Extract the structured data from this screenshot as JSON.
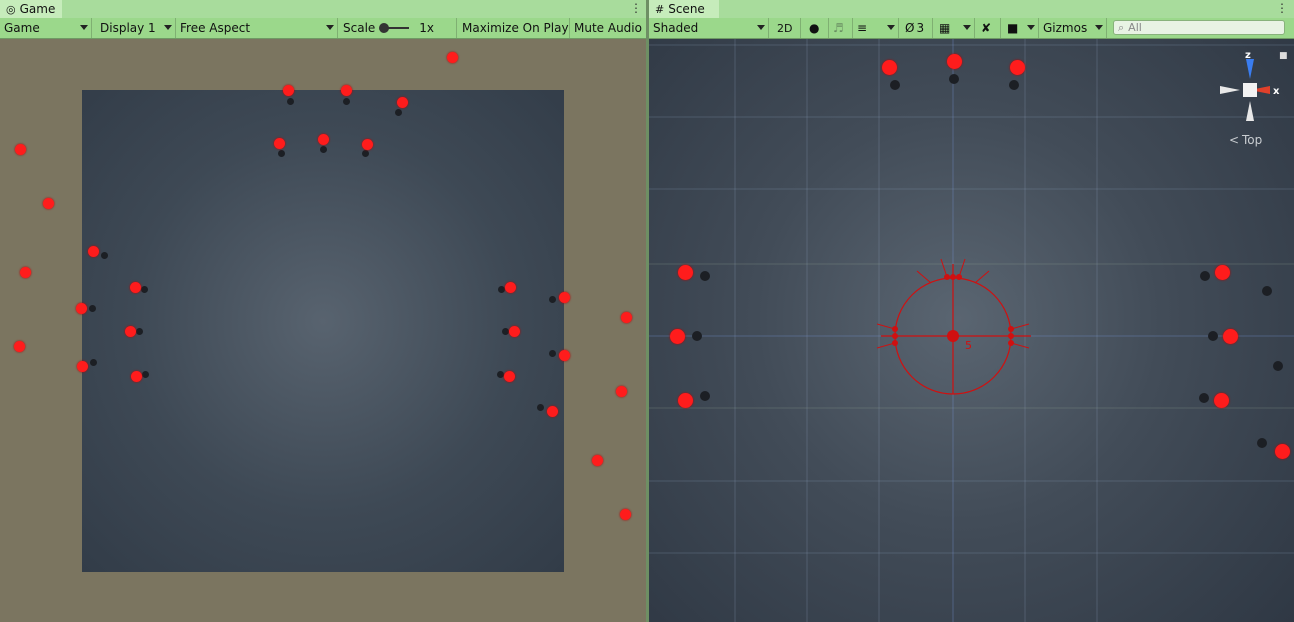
{
  "game_panel": {
    "tab_label": "Game",
    "toolbar": {
      "view_select": "Game",
      "display_select": "Display 1",
      "aspect_select": "Free Aspect",
      "scale_label": "Scale",
      "scale_value": "1x",
      "maximize_label": "Maximize On Play",
      "mute_label": "Mute Audio"
    }
  },
  "scene_panel": {
    "tab_label": "Scene",
    "toolbar": {
      "shading_select": "Shaded",
      "mode_2d": "2D",
      "hidden_count": "3",
      "gizmos_label": "Gizmos",
      "search_placeholder": "All"
    },
    "orientation_gizmo": {
      "axis_z": "z",
      "axis_x": "x",
      "view_label": "Top"
    },
    "selection_label": "5"
  },
  "colors": {
    "tab_bar": "#a8dc9c",
    "toolbar": "#9bd88b",
    "game_background": "#7b7560",
    "board": "#3e4955",
    "agent_red": "#ff1c1c",
    "selection_red": "#d01010"
  },
  "icons": [
    "gamepad-icon",
    "grid-icon",
    "light-icon",
    "audio-icon",
    "effects-icon",
    "visibility-icon",
    "grid-snap-icon",
    "tools-icon",
    "camera-icon",
    "search-icon",
    "lock-icon",
    "more-icon"
  ]
}
